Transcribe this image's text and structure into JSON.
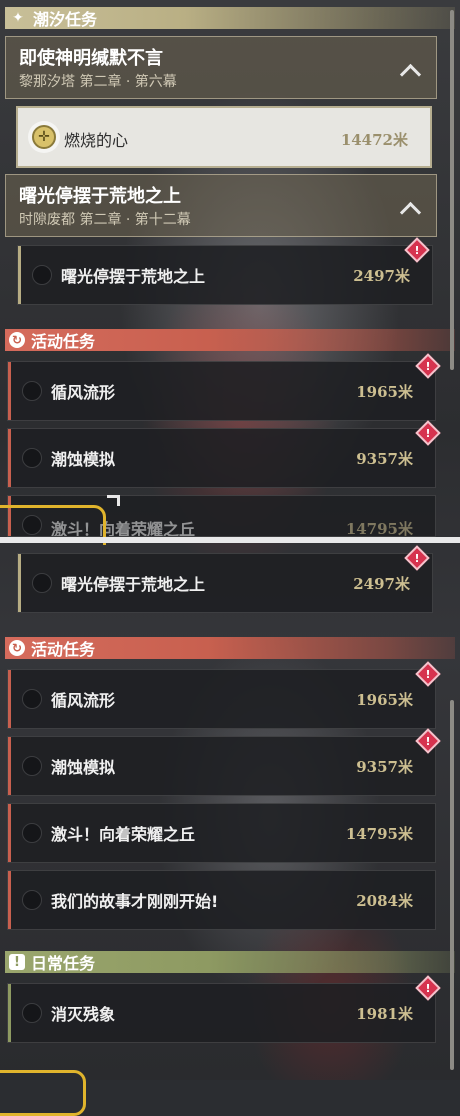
{
  "sections": {
    "tide": {
      "label": "潮汐任务",
      "icon": "star-sparkle-icon",
      "color": "#c8bf98"
    },
    "event": {
      "label": "活动任务",
      "icon": "refresh-circle-icon",
      "color": "#d56b5c"
    },
    "daily": {
      "label": "日常任务",
      "icon": "exclamation-box-icon",
      "color": "#9aa66d"
    }
  },
  "chapters": [
    {
      "title": "即使神明缄默不言",
      "subtitle": "黎那汐塔 第二章 · 第六幕"
    },
    {
      "title": "曙光停摆于荒地之上",
      "subtitle": "时隙废都 第二章 · 第十二幕"
    }
  ],
  "tasks_top": [
    {
      "name": "燃烧的心",
      "distance": "14472米",
      "state": "selected-tracked"
    },
    {
      "name": "曙光停摆于荒地之上",
      "distance": "2497米",
      "alert": true
    },
    {
      "name": "循风流形",
      "distance": "1965米",
      "alert": true
    },
    {
      "name": "潮蚀模拟",
      "distance": "9357米",
      "alert": true
    },
    {
      "name": "激斗！向着荣耀之丘",
      "distance": "14795米",
      "clipped": true
    }
  ],
  "tasks_bottom": [
    {
      "name": "曙光停摆于荒地之上",
      "distance": "2497米",
      "alert": true
    },
    {
      "name": "循风流形",
      "distance": "1965米",
      "alert": true
    },
    {
      "name": "潮蚀模拟",
      "distance": "9357米",
      "alert": true
    },
    {
      "name": "激斗！向着荣耀之丘",
      "distance": "14795米"
    },
    {
      "name": "我们的故事才刚刚开始!",
      "distance": "2084米"
    },
    {
      "name": "消灭残象",
      "distance": "1981米",
      "alert": true
    }
  ],
  "alert_glyph": "!",
  "colors": {
    "tide_bar": "#b7ad84",
    "event_bar": "#c8604f",
    "daily_bar": "#8e9a62",
    "alert": "#d6334f",
    "distance": "#cdbf91",
    "track_ring": "#e0b42c"
  }
}
